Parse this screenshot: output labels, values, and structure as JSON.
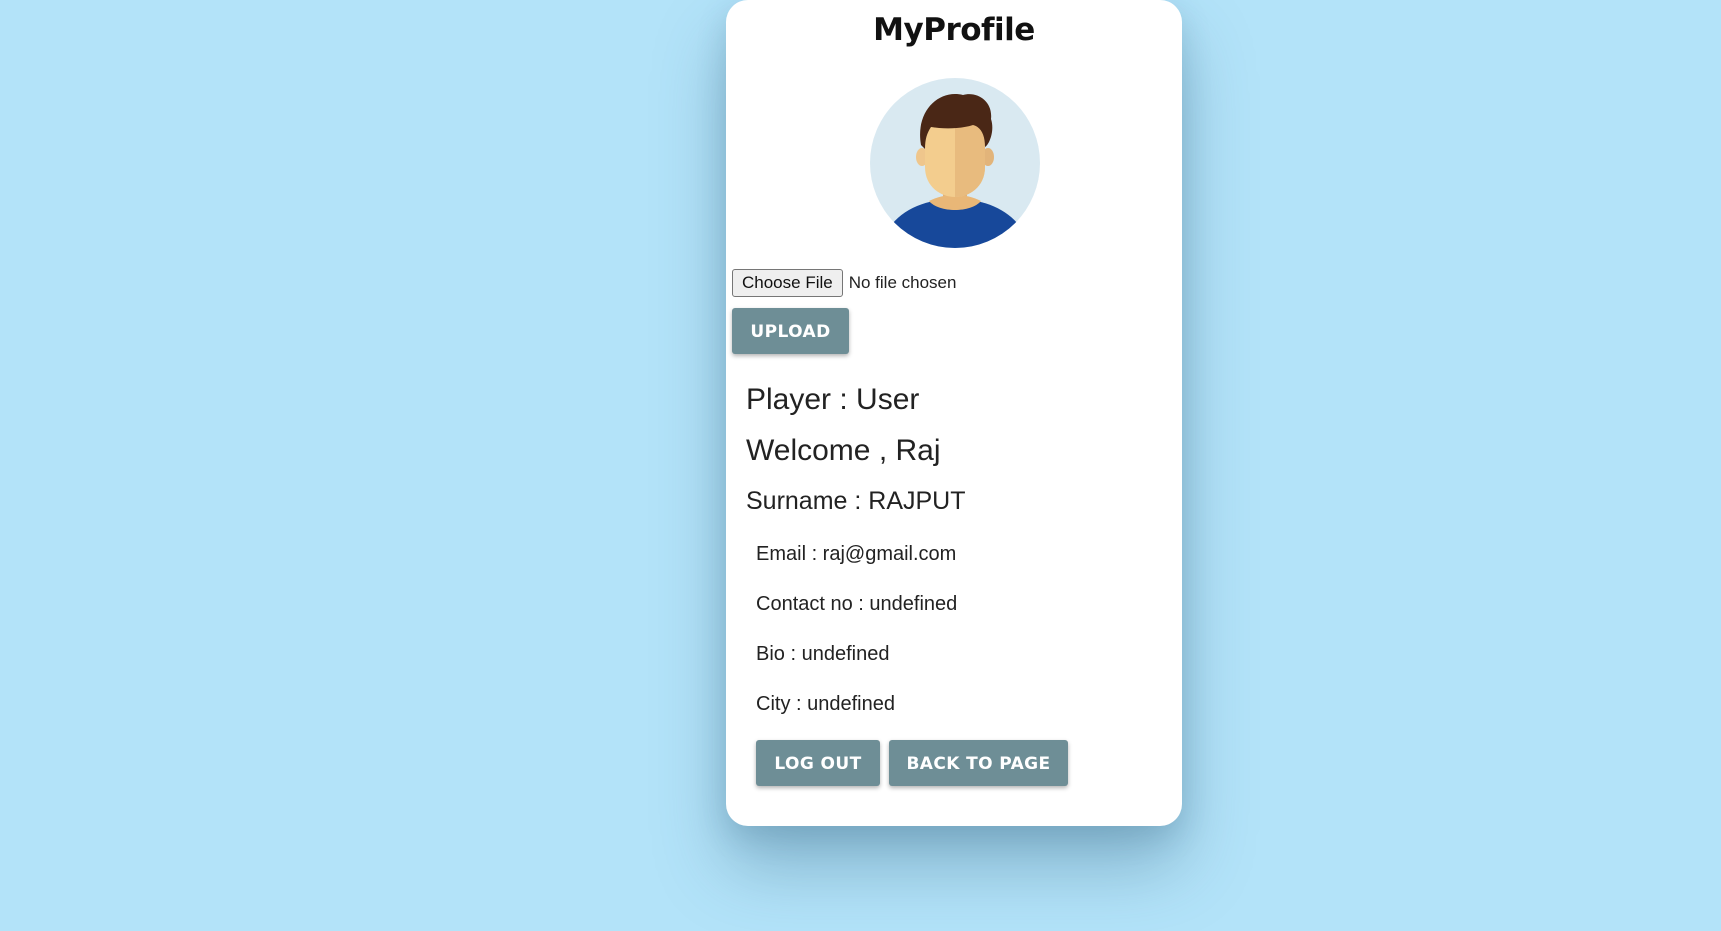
{
  "title": "MyProfile",
  "avatar": {
    "icon": "user-avatar-icon"
  },
  "file_input": {
    "button_label": "Choose File",
    "status": "No file chosen"
  },
  "buttons": {
    "upload": "UPLOAD",
    "logout": "LOG OUT",
    "back": "BACK TO PAGE"
  },
  "profile": {
    "player": "Player : User",
    "welcome": "Welcome , Raj",
    "surname": "Surname : RAJPUT",
    "email": "Email : raj@gmail.com",
    "contact": "Contact no : undefined",
    "bio": "Bio : undefined",
    "city": "City : undefined"
  },
  "colors": {
    "background": "#b3e3f9",
    "button": "#6e8e96"
  }
}
